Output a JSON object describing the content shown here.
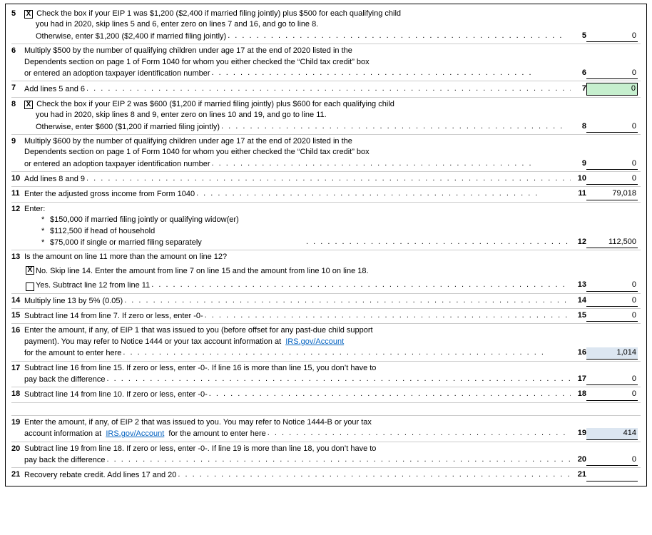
{
  "form": {
    "rows": [
      {
        "id": "row5",
        "line": "5",
        "checkbox": "X",
        "text_main": "Check the box if your EIP 1 was $1,200 ($2,400 if married filing jointly) plus $500 for each qualifying child",
        "text_sub1": "you had in 2020, skip lines 5 and 6, enter zero on lines 7 and 16, and go to line 8.",
        "text_sub2": "Otherwise, enter $1,200 ($2,400 if married filing jointly)",
        "field_num": "5",
        "field_value": "0",
        "highlighted": false
      },
      {
        "id": "row6",
        "line": "6",
        "text_main": "Multiply $500 by the number of qualifying children under age 17 at the end of 2020 listed in the",
        "text_sub1": "Dependents section on page 1 of Form 1040 for whom you either checked the “Child tax credit” box",
        "text_sub2": "or entered an adoption taxpayer identification number",
        "field_num": "6",
        "field_value": "0",
        "highlighted": false
      },
      {
        "id": "row7",
        "line": "7",
        "text_main": "Add lines 5 and 6",
        "field_num": "7",
        "field_value": "0",
        "highlighted": true
      },
      {
        "id": "row8",
        "line": "8",
        "checkbox": "X",
        "text_main": "Check the box if your EIP 2 was $600 ($1,200 if married filing jointly) plus $600 for each qualifying child",
        "text_sub1": "you had in 2020, skip lines 8 and 9, enter zero on lines 10 and 19, and go to line 11.",
        "text_sub2": "Otherwise, enter $600 ($1,200 if married filing jointly)",
        "field_num": "8",
        "field_value": "0",
        "highlighted": false
      },
      {
        "id": "row9",
        "line": "9",
        "text_main": "Multiply $600 by the number of qualifying children under age 17 at the end of 2020 listed in the",
        "text_sub1": "Dependents section on page 1 of Form 1040 for whom you either checked the “Child tax credit” box",
        "text_sub2": "or entered an adoption taxpayer identification number",
        "field_num": "9",
        "field_value": "0",
        "highlighted": false
      },
      {
        "id": "row10",
        "line": "10",
        "text_main": "Add lines 8 and 9",
        "field_num": "10",
        "field_value": "0",
        "highlighted": false
      },
      {
        "id": "row11",
        "line": "11",
        "text_main": "Enter the adjusted gross income from Form 1040",
        "field_num": "11",
        "field_value": "79,018",
        "highlighted": false
      },
      {
        "id": "row12",
        "line": "12",
        "text_main": "Enter:",
        "bullet1": "$150,000 if married filing jointly or qualifying widow(er)",
        "bullet2": "$112,500 if head of household",
        "bullet3": "$75,000 if single or married filing separately",
        "field_num": "12",
        "field_value": "112,500",
        "highlighted": false
      },
      {
        "id": "row13a",
        "line": "13",
        "text_main": "Is the amount on line 11 more than the amount on line 12?"
      },
      {
        "id": "row13b",
        "checkbox_no": "X",
        "text_no": "No. Skip line 14. Enter the amount from line 7 on line 15 and the amount from line 10 on line 18."
      },
      {
        "id": "row13c",
        "text_yes": "Yes. Subtract line 12 from line 11",
        "field_num": "13",
        "field_value": "0",
        "highlighted": false
      },
      {
        "id": "row14",
        "line": "14",
        "text_main": "Multiply line 13 by 5% (0.05)",
        "field_num": "14",
        "field_value": "0",
        "highlighted": false
      },
      {
        "id": "row15",
        "line": "15",
        "text_main": "Subtract line 14 from line 7. If zero or less, enter -0-",
        "field_num": "15",
        "field_value": "0",
        "highlighted": false
      },
      {
        "id": "row16",
        "line": "16",
        "text_main": "Enter the amount, if any, of EIP 1 that was issued to you (before offset for any past-due child support",
        "text_sub1": "payment). You may refer to Notice 1444 or your tax account information at",
        "link": "IRS.gov/Account",
        "text_sub2": "for the amount to enter here",
        "field_num": "16",
        "field_value": "1,014",
        "highlighted": false,
        "blue": true
      },
      {
        "id": "row17",
        "line": "17",
        "text_main": "Subtract line 16 from line 15. If zero or less, enter -0-. If line 16 is more than line 15, you don’t have to",
        "text_sub1": "pay back the difference",
        "field_num": "17",
        "field_value": "0",
        "highlighted": false
      },
      {
        "id": "row18",
        "line": "18",
        "text_main": "Subtract line 14 from line 10. If zero or less, enter -0-",
        "field_num": "18",
        "field_value": "0",
        "highlighted": false
      },
      {
        "id": "row19",
        "line": "19",
        "text_main": "Enter the amount, if any, of EIP 2 that was issued to you. You may refer to Notice 1444-B or your tax",
        "text_sub1": "account information at",
        "link": "IRS.gov/Account",
        "text_sub2": "for the amount to enter here",
        "field_num": "19",
        "field_value": "414",
        "highlighted": false,
        "blue": true
      },
      {
        "id": "row20",
        "line": "20",
        "text_main": "Subtract line 19 from line 18. If zero or less, enter -0-. If line 19 is more than line 18, you don’t have to",
        "text_sub1": "pay back the difference",
        "field_num": "20",
        "field_value": "0",
        "highlighted": false
      },
      {
        "id": "row21",
        "line": "21",
        "text_main": "Recovery rebate credit. Add lines 17 and 20",
        "field_num": "21",
        "field_value": "",
        "highlighted": false
      }
    ]
  }
}
